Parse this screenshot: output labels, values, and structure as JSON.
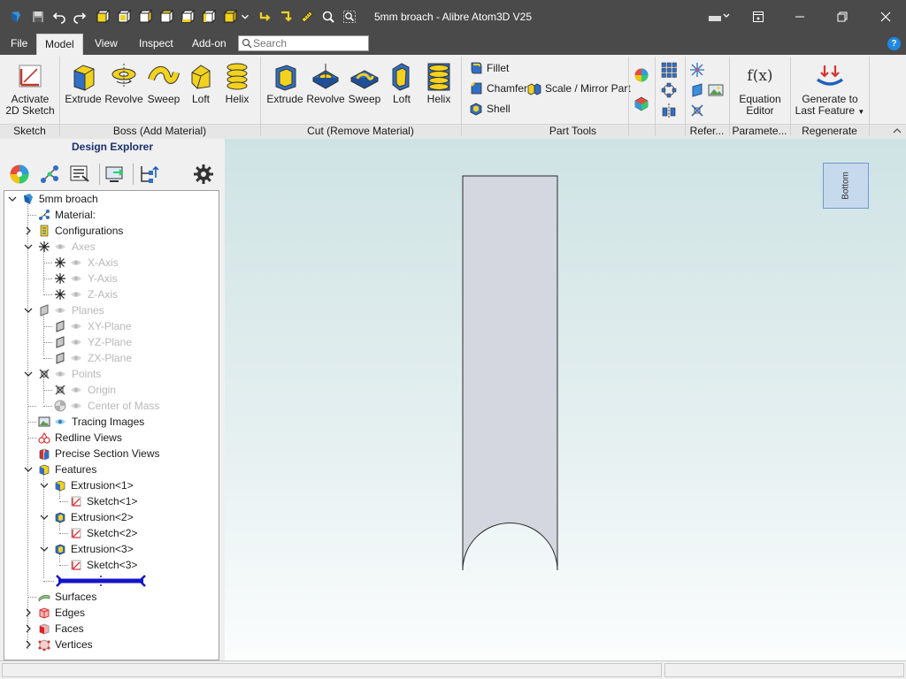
{
  "window": {
    "title": "5mm broach - Alibre Atom3D V25"
  },
  "menu": {
    "tabs": [
      {
        "label": "File"
      },
      {
        "label": "Model"
      },
      {
        "label": "View"
      },
      {
        "label": "Inspect"
      },
      {
        "label": "Add-on"
      }
    ],
    "search_placeholder": "Search",
    "help": "?"
  },
  "ribbon": {
    "activate_sketch": {
      "line1": "Activate",
      "line2": "2D Sketch"
    },
    "boss": {
      "extrude": "Extrude",
      "revolve": "Revolve",
      "sweep": "Sweep",
      "loft": "Loft",
      "helix": "Helix"
    },
    "cut": {
      "extrude": "Extrude",
      "revolve": "Revolve",
      "sweep": "Sweep",
      "loft": "Loft",
      "helix": "Helix"
    },
    "part_tools": {
      "fillet": "Fillet",
      "chamfer": "Chamfer",
      "shell": "Shell",
      "scale_mirror": "Scale / Mirror Part"
    },
    "equation_editor": {
      "line1": "Equation",
      "line2": "Editor"
    },
    "equation_glyph": "f(x)",
    "generate": {
      "line1": "Generate to",
      "line2": "Last Feature"
    },
    "groups": {
      "sketch": "Sketch",
      "boss": "Boss (Add Material)",
      "cut": "Cut (Remove Material)",
      "part_tools": "Part Tools",
      "reference": "Refer...",
      "parameters": "Paramete...",
      "regenerate": "Regenerate"
    }
  },
  "explorer": {
    "title": "Design Explorer",
    "tree": {
      "root": "5mm broach",
      "material": "Material:",
      "configurations": "Configurations",
      "axes": "Axes",
      "x_axis": "X-Axis",
      "y_axis": "Y-Axis",
      "z_axis": "Z-Axis",
      "planes": "Planes",
      "xy_plane": "XY-Plane",
      "yz_plane": "YZ-Plane",
      "zx_plane": "ZX-Plane",
      "points": "Points",
      "origin": "Origin",
      "center_of_mass": "Center of Mass",
      "tracing_images": "Tracing Images",
      "redline_views": "Redline Views",
      "precise_section_views": "Precise Section Views",
      "features": "Features",
      "extrusion1": "Extrusion<1>",
      "sketch1": "Sketch<1>",
      "extrusion2": "Extrusion<2>",
      "sketch2": "Sketch<2>",
      "extrusion3": "Extrusion<3>",
      "sketch3": "Sketch<3>",
      "surfaces": "Surfaces",
      "edges": "Edges",
      "faces": "Faces",
      "vertices": "Vertices"
    }
  },
  "viewport": {
    "view_cube_label": "Bottom"
  },
  "colors": {
    "titlebar": "#4a4a4a",
    "accent_blue": "#1f5fbf",
    "yellow_feature": "#f2d21f",
    "part_fill": "#d4d7e0"
  }
}
